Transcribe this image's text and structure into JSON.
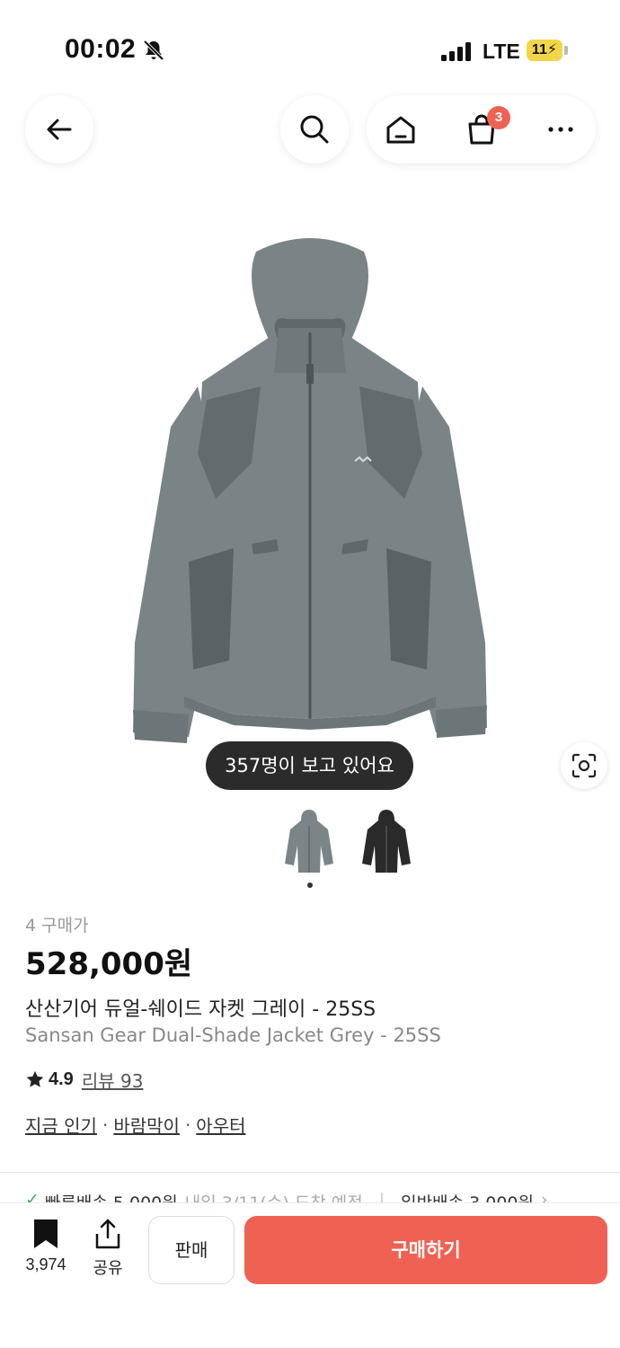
{
  "status_bar": {
    "time": "00:02",
    "network": "LTE",
    "battery": "11"
  },
  "nav": {
    "cart_count": "3"
  },
  "product": {
    "viewers_text": "357명이 보고 있어요",
    "buyer_label": "4 구매가",
    "price": "528,000원",
    "name_ko": "산산기어 듀얼-쉐이드 자켓 그레이 - 25SS",
    "name_en": "Sansan Gear Dual-Shade Jacket Grey - 25SS",
    "rating": "4.9",
    "review_label": "리뷰 93",
    "tags": [
      "지금 인기",
      "바람막이",
      "아우터"
    ],
    "tag_separator": "·",
    "thumbnails": [
      {
        "color": "#7b8487",
        "name": "grey"
      },
      {
        "color": "#2a2a2a",
        "name": "black"
      }
    ],
    "image_colors": {
      "body": "#7a8386",
      "panel": "#626b6e",
      "shadow": "#5a6265"
    }
  },
  "delivery": {
    "fast_label": "빠른배송 5,000원",
    "fast_detail": "내일 3/11(수) 도착 예정",
    "normal_label": "일반배송 3,000원",
    "chevron": "›"
  },
  "bottom_bar": {
    "bookmark_count": "3,974",
    "share_label": "공유",
    "sell_label": "판매",
    "buy_label": "구매하기"
  },
  "colors": {
    "accent": "#ef6253",
    "text": "#222222",
    "muted": "#999999"
  },
  "icons": [
    "back-arrow-icon",
    "search-icon",
    "home-icon",
    "shopping-bag-icon",
    "more-icon",
    "scan-icon",
    "star-icon",
    "bookmark-icon",
    "share-icon",
    "bell-off-icon",
    "signal-icon",
    "battery-icon"
  ]
}
